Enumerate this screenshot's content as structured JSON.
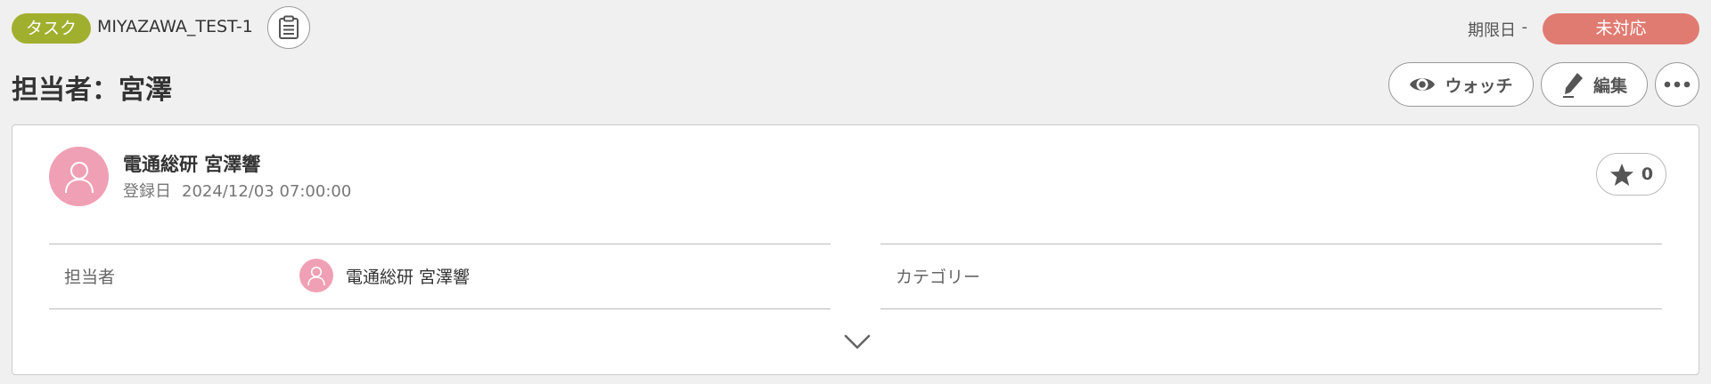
{
  "header": {
    "type_label": "タスク",
    "issue_key": "MIYAZAWA_TEST-1",
    "due_label": "期限日",
    "due_value": "-",
    "status_label": "未対応",
    "status_color": "#e07b72",
    "type_color": "#a1af2f"
  },
  "title": "担当者：宮澤",
  "actions": {
    "watch_label": "ウォッチ",
    "edit_label": "編集"
  },
  "card": {
    "creator_name": "電通総研 宮澤響",
    "created_label": "登録日",
    "created_value": "2024/12/03 07:00:00",
    "star_count": "0",
    "fields": {
      "assignee_label": "担当者",
      "assignee_value": "電通総研 宮澤響",
      "category_label": "カテゴリー"
    }
  },
  "icons": {
    "copy": "clipboard-icon",
    "watch": "eye-icon",
    "edit": "pencil-icon",
    "more": "more-dots-icon",
    "star": "star-icon",
    "avatar": "user-avatar-icon",
    "expand": "chevron-down-icon"
  }
}
